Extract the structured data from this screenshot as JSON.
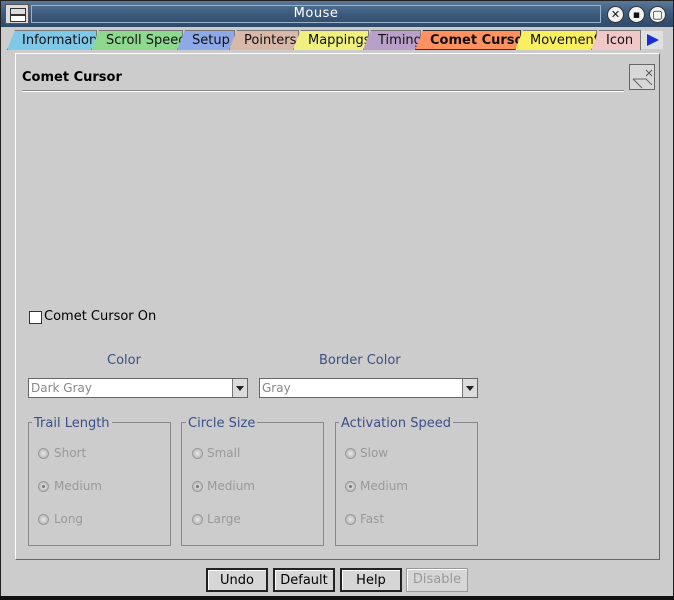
{
  "window": {
    "title": "Mouse"
  },
  "tabs": [
    {
      "label": "Information",
      "color": "#7fc8e8"
    },
    {
      "label": "Scroll Speed",
      "color": "#8fd88f"
    },
    {
      "label": "Setup",
      "color": "#8fa8e8"
    },
    {
      "label": "Pointers",
      "color": "#d8b8a8"
    },
    {
      "label": "Mappings",
      "color": "#f0f080"
    },
    {
      "label": "Timing",
      "color": "#b8a0c8"
    },
    {
      "label": "Comet Cursor",
      "color": "#ff9060"
    },
    {
      "label": "Movement",
      "color": "#f8f060"
    },
    {
      "label": "Icon",
      "color": "#f0c8c8"
    }
  ],
  "panel": {
    "title": "Comet Cursor"
  },
  "comet": {
    "checkbox_label": "Comet Cursor On"
  },
  "color": {
    "label": "Color",
    "value": "Dark Gray"
  },
  "border_color": {
    "label": "Border Color",
    "value": "Gray"
  },
  "trail": {
    "title": "Trail Length",
    "options": [
      "Short",
      "Medium",
      "Long"
    ]
  },
  "circle": {
    "title": "Circle Size",
    "options": [
      "Small",
      "Medium",
      "Large"
    ]
  },
  "activation": {
    "title": "Activation Speed",
    "options": [
      "Slow",
      "Medium",
      "Fast"
    ]
  },
  "buttons": {
    "undo": "Undo",
    "default": "Default",
    "help": "Help",
    "disable": "Disable"
  }
}
